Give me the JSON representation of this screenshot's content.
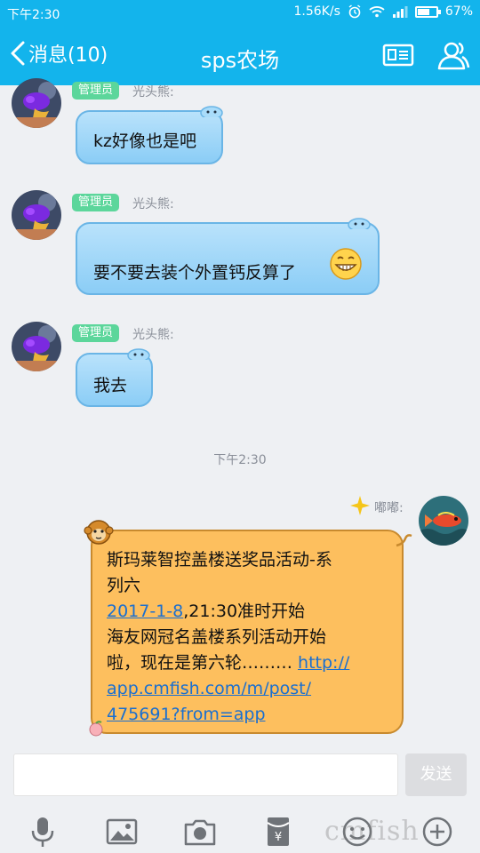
{
  "status_bar": {
    "time": "下午2:30",
    "network_speed": "1.56K/s",
    "battery_percent": "67%",
    "battery_level": 0.67
  },
  "header": {
    "back_label": "消息(10)",
    "title": "sps农场"
  },
  "messages": [
    {
      "role": "管理员",
      "sender": "光头熊:",
      "text": "kz好像也是吧"
    },
    {
      "role": "管理员",
      "sender": "光头熊:",
      "text": "要不要去装个外置钙反算了"
    },
    {
      "role": "管理员",
      "sender": "光头熊:",
      "text": "我去"
    }
  ],
  "timestamp": "下午2:30",
  "own_message": {
    "sender": "嘟嘟:",
    "line1": "斯玛莱智控盖楼送奖品活动-系",
    "line2": "列六",
    "date_link": "2017-1-8",
    "line3_rest": ",21:30准时开始",
    "line4": "海友网冠名盖楼系列活动开始",
    "line5_text": "啦，现在是第六轮……… ",
    "url_part1": "http://",
    "url_part2": "app.cmfish.com/m/post/",
    "url_part3": "475691?from=app"
  },
  "composer": {
    "input_value": "",
    "send_label": "发送"
  },
  "toolbar_icons": [
    "microphone-icon",
    "image-icon",
    "camera-icon",
    "red-packet-icon",
    "emoji-icon",
    "plus-icon"
  ],
  "watermark": "cmfish",
  "colors": {
    "header": "#13b4ec",
    "bubble_blue": "#a6d8f8",
    "bubble_orange": "#fdbf5e",
    "admin_badge": "#5cd69b",
    "link": "#1a6fd0"
  }
}
